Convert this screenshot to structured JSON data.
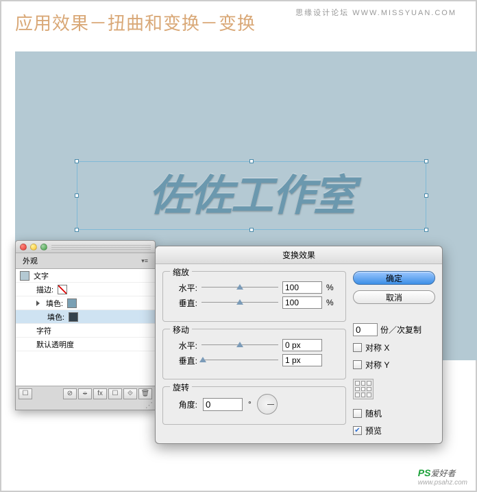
{
  "page_title": "应用效果－扭曲和变换－变换",
  "watermark_top": "思缘设计论坛  WWW.MISSYUAN.COM",
  "text_object": "佐佐工作室",
  "appearance": {
    "tab": "外观",
    "rows": {
      "text": "文字",
      "stroke": "描边:",
      "fill1": "填色:",
      "fill2": "填色:",
      "char": "字符",
      "opacity": "默认透明度"
    }
  },
  "dialog": {
    "title": "变换效果",
    "scale": {
      "legend": "缩放",
      "h_label": "水平:",
      "h_value": "100",
      "h_unit": "%",
      "v_label": "垂直:",
      "v_value": "100",
      "v_unit": "%"
    },
    "move": {
      "legend": "移动",
      "h_label": "水平:",
      "h_value": "0 px",
      "v_label": "垂直:",
      "v_value": "1 px"
    },
    "rotate": {
      "legend": "旋转",
      "a_label": "角度:",
      "a_value": "0",
      "a_unit": "°"
    },
    "buttons": {
      "ok": "确定",
      "cancel": "取消"
    },
    "copies": {
      "value": "0",
      "label": "份／次复制"
    },
    "options": {
      "reflect_x": "对称 X",
      "reflect_y": "对称 Y",
      "random": "随机",
      "preview": "预览"
    }
  },
  "watermark_bot": {
    "ps": "PS",
    "cn": "爱好者",
    "url": "www.psahz.com"
  }
}
